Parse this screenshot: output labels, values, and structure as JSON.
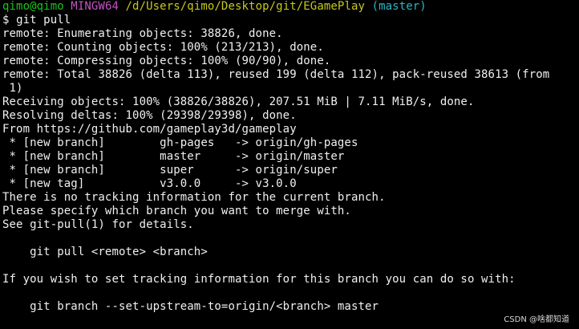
{
  "prompt": {
    "user_host": "qimo@qimo",
    "env": "MINGW64",
    "path": "/d/Users/qimo/Desktop/git/EGamePlay",
    "branch": "(master)"
  },
  "command": {
    "symbol": "$",
    "text": "git pull"
  },
  "output_lines": [
    "remote: Enumerating objects: 38826, done.",
    "remote: Counting objects: 100% (213/213), done.",
    "remote: Compressing objects: 100% (90/90), done.",
    "remote: Total 38826 (delta 113), reused 199 (delta 112), pack-reused 38613 (from",
    " 1)",
    "Receiving objects: 100% (38826/38826), 207.51 MiB | 7.11 MiB/s, done.",
    "Resolving deltas: 100% (29398/29398), done.",
    "From https://github.com/gameplay3d/gameplay",
    " * [new branch]        gh-pages   -> origin/gh-pages",
    " * [new branch]        master     -> origin/master",
    " * [new branch]        super      -> origin/super",
    " * [new tag]           v3.0.0     -> v3.0.0",
    "There is no tracking information for the current branch.",
    "Please specify which branch you want to merge with.",
    "See git-pull(1) for details.",
    "",
    "    git pull <remote> <branch>",
    "",
    "If you wish to set tracking information for this branch you can do so with:",
    "",
    "    git branch --set-upstream-to=origin/<branch> master"
  ],
  "watermark": "CSDN @啥都知道"
}
